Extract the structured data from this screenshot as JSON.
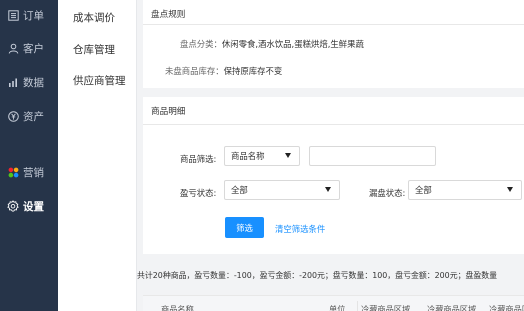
{
  "nav": {
    "items": [
      {
        "label": "订单",
        "icon": "list-icon"
      },
      {
        "label": "客户",
        "icon": "user-icon"
      },
      {
        "label": "数据",
        "icon": "bar-chart-icon"
      },
      {
        "label": "资产",
        "icon": "yen-icon"
      },
      {
        "label": "营销",
        "icon": "grid-icon"
      },
      {
        "label": "设置",
        "icon": "gear-icon"
      }
    ],
    "active_label": "设置",
    "accent_colors": [
      "#f5222d",
      "#faad14",
      "#52c41a",
      "#1890ff"
    ]
  },
  "subnav": {
    "items": [
      "成本调价",
      "仓库管理",
      "供应商管理"
    ]
  },
  "rules": {
    "title": "盘点规则",
    "category_label": "盘点分类：",
    "category_value": "休闲零食,酒水饮品,蛋糕烘焙,生鲜果蔬",
    "uncounted_label": "未盘商品库存：",
    "uncounted_value": "保持原库存不变"
  },
  "details": {
    "title": "商品明细",
    "filter_label": "商品筛选:",
    "filter_select": "商品名称",
    "filter_input_value": "",
    "profit_label": "盈亏状态:",
    "profit_select": "全部",
    "missing_label": "漏盘状态:",
    "missing_select": "全部",
    "filter_button": "筛选",
    "clear_link": "清空筛选条件"
  },
  "summary": "共计20种商品，盈亏数量：-100，盈亏金额：-200元；盘亏数量：100，盘亏金额：200元；盘盈数量",
  "table": {
    "headers": [
      "商品名称",
      "单位",
      "冷藏商品区域",
      "冷藏商品区域",
      "冷藏商品区"
    ]
  },
  "colors": {
    "sidebar_bg": "#263449",
    "primary": "#1890ff"
  }
}
